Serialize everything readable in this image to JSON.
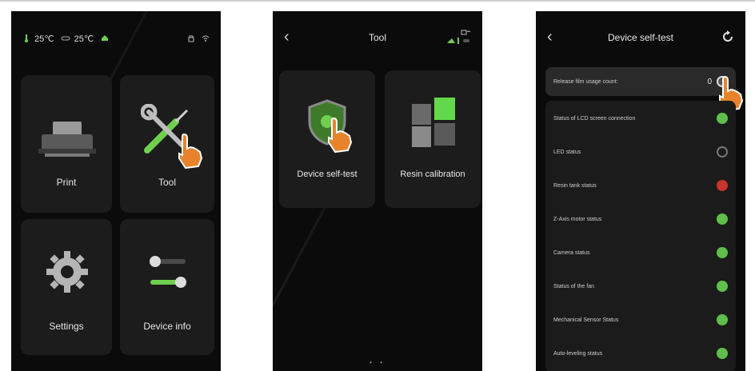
{
  "screen1": {
    "status": {
      "temp1": "25℃",
      "temp2": "25℃"
    },
    "tiles": [
      {
        "label": "Print",
        "icon": "printer-icon"
      },
      {
        "label": "Tool",
        "icon": "wrench-screwdriver-icon"
      },
      {
        "label": "Settings",
        "icon": "gear-icon"
      },
      {
        "label": "Device info",
        "icon": "toggle-switch-icon"
      }
    ]
  },
  "screen2": {
    "title": "Tool",
    "back": "‹",
    "tiles": [
      {
        "label": "Device self-test",
        "icon": "shield-icon"
      },
      {
        "label": "Resin calibration",
        "icon": "cubes-icon"
      }
    ],
    "pager": "• •"
  },
  "screen3": {
    "title": "Device self-test",
    "back": "‹",
    "release_label": "Release film usage count:",
    "release_value": "0",
    "items": [
      {
        "label": "Status of LCD screen connection",
        "status": "ok"
      },
      {
        "label": "LED status",
        "status": "wait"
      },
      {
        "label": "Resin tank status",
        "status": "err"
      },
      {
        "label": "Z-Axis motor status",
        "status": "ok"
      },
      {
        "label": "Camera status",
        "status": "ok"
      },
      {
        "label": "Status of the fan",
        "status": "ok"
      },
      {
        "label": "Mechanical Sensor Status",
        "status": "ok"
      },
      {
        "label": "Auto-leveling status",
        "status": "ok"
      }
    ]
  },
  "colors": {
    "ok": "#5fbf4a",
    "err": "#c8352c",
    "hand": "#e8832c",
    "tile": "#1c1c1c"
  }
}
